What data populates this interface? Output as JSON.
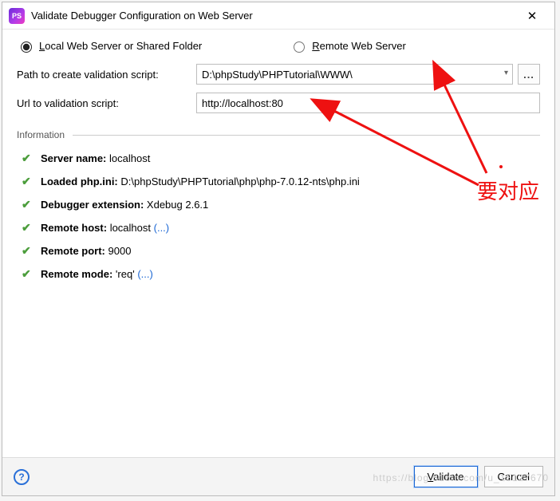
{
  "window": {
    "app_icon_label": "PS",
    "title": "Validate Debugger Configuration on Web Server"
  },
  "radio": {
    "local": "Local Web Server or Shared Folder",
    "remote": "Remote Web Server",
    "local_underline": "L",
    "remote_underline": "R"
  },
  "form": {
    "path_label": "Path to create validation script:",
    "path_value": "D:\\phpStudy\\PHPTutorial\\WWW\\",
    "browse_label": "...",
    "url_label": "Url to validation script:",
    "url_value": "http://localhost:80"
  },
  "information": {
    "heading": "Information",
    "items": [
      {
        "key": "Server name:",
        "value": "localhost",
        "link": ""
      },
      {
        "key": "Loaded php.ini:",
        "value": "D:\\phpStudy\\PHPTutorial\\php\\php-7.0.12-nts\\php.ini",
        "link": ""
      },
      {
        "key": "Debugger extension:",
        "value": "Xdebug 2.6.1",
        "link": ""
      },
      {
        "key": "Remote host:",
        "value": "localhost",
        "link": "(...)"
      },
      {
        "key": "Remote port:",
        "value": "9000",
        "link": ""
      },
      {
        "key": "Remote mode:",
        "value": "'req'",
        "link": "(...)"
      }
    ]
  },
  "footer": {
    "help_label": "?",
    "validate": "Validate",
    "validate_u": "V",
    "cancel": "Cancel"
  },
  "annotation": {
    "text": "要对应"
  },
  "watermark": "https://blog.51cto.com/u_15127670"
}
